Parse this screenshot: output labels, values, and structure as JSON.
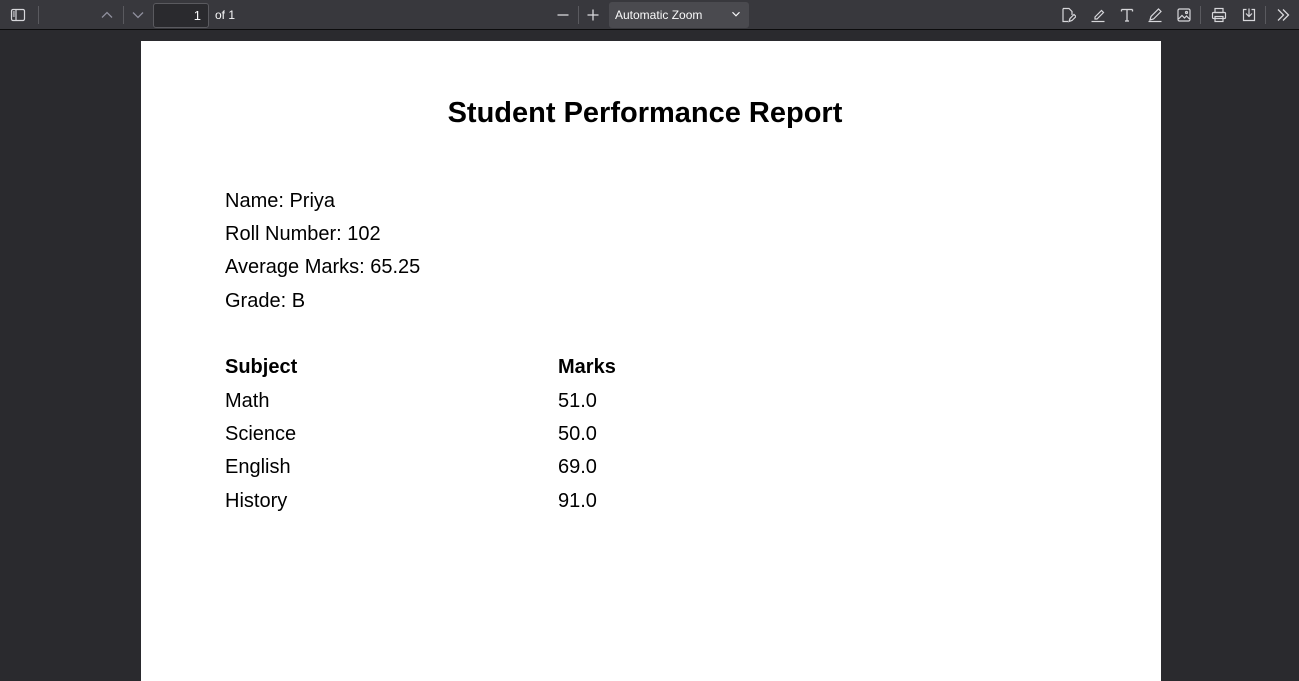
{
  "toolbar": {
    "page_number": "1",
    "page_count": "of 1",
    "zoom": "Automatic Zoom"
  },
  "document": {
    "title": "Student Performance Report",
    "info": [
      "Name: Priya",
      "Roll Number: 102",
      "Average Marks: 65.25",
      "Grade: B"
    ],
    "table": {
      "headers": [
        "Subject",
        "Marks"
      ],
      "rows": [
        [
          "Math",
          "51.0"
        ],
        [
          "Science",
          "50.0"
        ],
        [
          "English",
          "69.0"
        ],
        [
          "History",
          "91.0"
        ]
      ]
    }
  },
  "colors": {
    "toolbar_bg": "#38383d",
    "viewer_bg": "#2a2a2e",
    "page_bg": "#ffffff",
    "icon": "#f9f9fa"
  }
}
